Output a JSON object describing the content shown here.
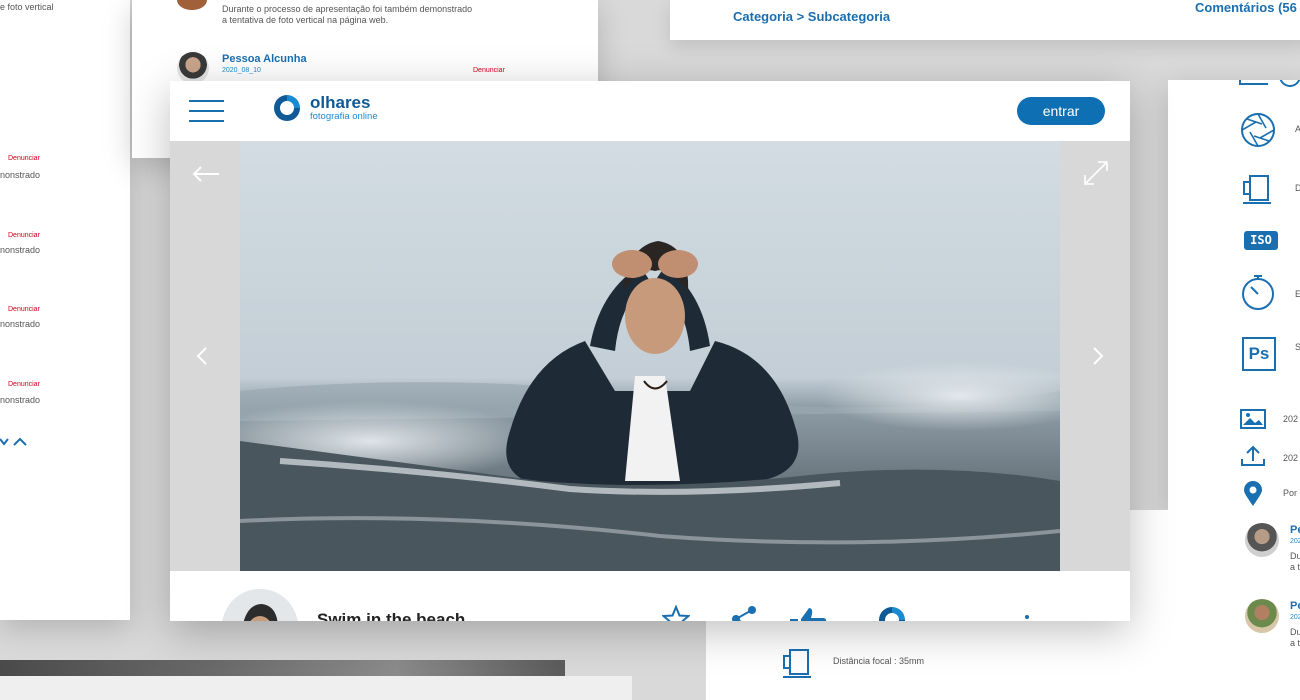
{
  "background": {
    "left_card": {
      "lines": [
        "e foto vertical",
        "nonstrado",
        "nonstrado",
        "nonstrado",
        "nonstrado"
      ],
      "report_label": "Denunciar"
    },
    "top_card": {
      "comment_text_line1": "Durante o processo de apresentação foi também demonstrado",
      "comment_text_line2": "a tentativa de foto vertical na página web.",
      "author": "Pessoa Alcunha",
      "date": "2020_08_10",
      "report_label": "Denunciar"
    },
    "top_right": {
      "breadcrumb": "Categoria > Subcategoria",
      "comments": "Comentários (56"
    },
    "right_panel": {
      "items": [
        {
          "icon": "aperture-icon",
          "text": "A"
        },
        {
          "icon": "focal-length-icon",
          "text": "D"
        },
        {
          "icon": "iso-icon",
          "text": "ISO"
        },
        {
          "icon": "stopwatch-icon",
          "text": "E"
        },
        {
          "icon": "photoshop-icon",
          "text": "S"
        },
        {
          "icon": "image-icon",
          "text": "202"
        },
        {
          "icon": "upload-icon",
          "text": "202"
        },
        {
          "icon": "location-pin-icon",
          "text": "Por"
        }
      ],
      "comments": [
        {
          "name": "Pe",
          "date": "202",
          "text1": "Du",
          "text2": "a t"
        },
        {
          "name": "Pe",
          "date": "202",
          "text1": "Du",
          "text2": "a t"
        }
      ]
    },
    "bottom_center": {
      "focal_distance": "Distância focal : 35mm"
    }
  },
  "header": {
    "logo_name": "olhares",
    "logo_subtitle": "fotografia online",
    "login_label": "entrar"
  },
  "viewer": {
    "back_icon": "arrow-left-icon",
    "expand_icon": "expand-icon",
    "prev_icon": "chevron-left-icon",
    "next_icon": "chevron-right-icon"
  },
  "footer": {
    "title": "Swim in the beach",
    "actions": [
      "star-icon",
      "share-icon",
      "like-icon",
      "logo-icon"
    ]
  },
  "colors": {
    "brand_blue": "#0e6fb3",
    "link_blue": "#1a6fb0",
    "report_red": "#d0021b"
  }
}
